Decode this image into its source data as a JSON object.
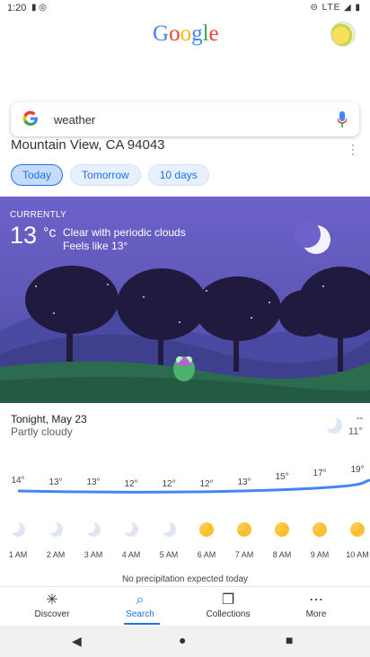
{
  "status_bar": {
    "time": "1:20",
    "network": "LTE"
  },
  "header": {
    "logo_letters": [
      {
        "ch": "G",
        "color": "#4285F4"
      },
      {
        "ch": "o",
        "color": "#EA4335"
      },
      {
        "ch": "o",
        "color": "#FBBC05"
      },
      {
        "ch": "g",
        "color": "#4285F4"
      },
      {
        "ch": "l",
        "color": "#34A853"
      },
      {
        "ch": "e",
        "color": "#EA4335"
      }
    ]
  },
  "search": {
    "query": "weather"
  },
  "weather": {
    "location": "Mountain View, CA 94043",
    "tabs": [
      {
        "label": "Today",
        "active": true
      },
      {
        "label": "Tomorrow",
        "active": false
      },
      {
        "label": "10 days",
        "active": false
      }
    ],
    "currently_label": "CURRENTLY",
    "temperature": "13",
    "unit": "°c",
    "condition": "Clear with periodic clouds",
    "feels_like": "Feels like 13°",
    "tonight": {
      "label": "Tonight, May 23",
      "condition": "Partly cloudy",
      "high": "--",
      "low": "11°"
    },
    "hourly": [
      {
        "time": "1 AM",
        "temp": "14°",
        "icon": "moon-icon"
      },
      {
        "time": "2 AM",
        "temp": "13°",
        "icon": "moon-icon"
      },
      {
        "time": "3 AM",
        "temp": "13°",
        "icon": "moon-icon"
      },
      {
        "time": "4 AM",
        "temp": "12°",
        "icon": "moon-icon"
      },
      {
        "time": "5 AM",
        "temp": "12°",
        "icon": "moon-icon"
      },
      {
        "time": "6 AM",
        "temp": "12°",
        "icon": "sun-icon"
      },
      {
        "time": "7 AM",
        "temp": "13°",
        "icon": "sun-icon"
      },
      {
        "time": "8 AM",
        "temp": "15°",
        "icon": "sun-icon"
      },
      {
        "time": "9 AM",
        "temp": "17°",
        "icon": "sun-icon"
      },
      {
        "time": "10 AM",
        "temp": "19°",
        "icon": "sun-icon"
      }
    ],
    "precipitation_note": "No precipitation expected today"
  },
  "bottom_nav": [
    {
      "label": "Discover",
      "icon": "asterisk-icon",
      "active": false
    },
    {
      "label": "Search",
      "icon": "search-icon",
      "active": true
    },
    {
      "label": "Collections",
      "icon": "collections-icon",
      "active": false
    },
    {
      "label": "More",
      "icon": "more-icon",
      "active": false
    }
  ],
  "colors": {
    "accent": "#1a73e8",
    "scene_bg": "#5d57b6",
    "sun": "#FBC02D"
  }
}
